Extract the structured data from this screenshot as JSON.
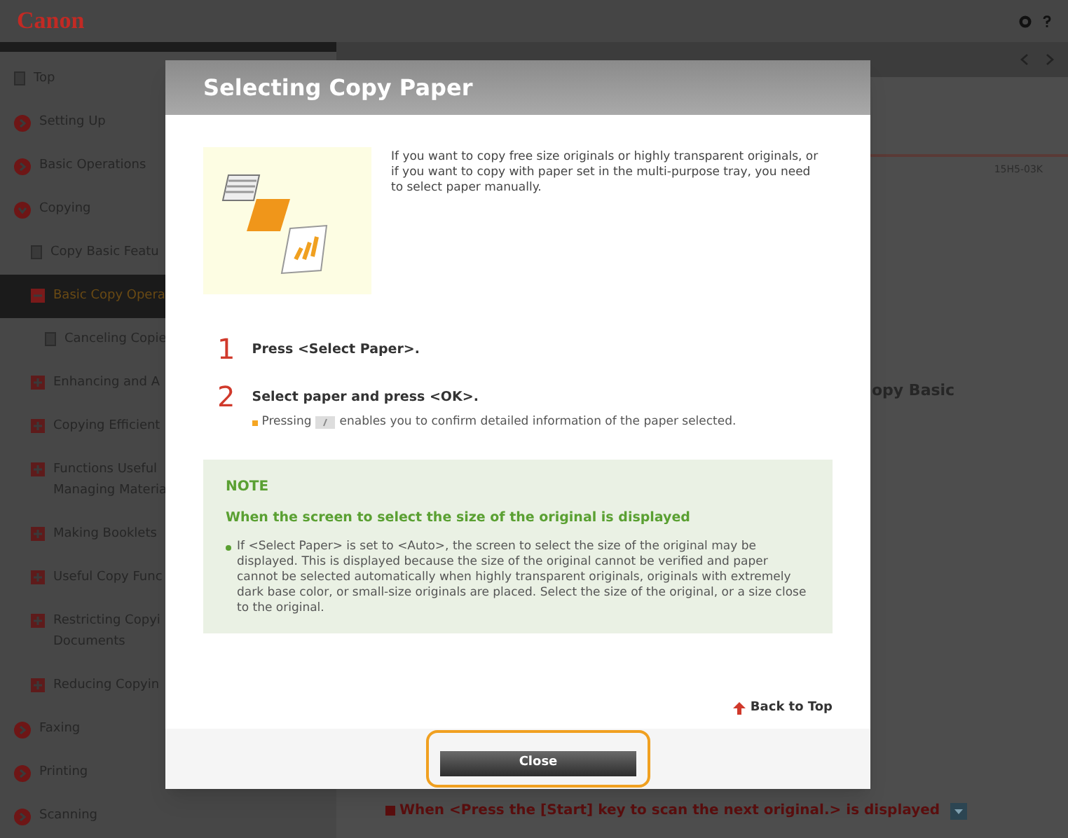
{
  "header": {
    "logo": "Canon"
  },
  "sidebar": {
    "items": [
      {
        "label": "Top",
        "kind": "page",
        "selected": false
      },
      {
        "label": "Setting Up",
        "kind": "section",
        "expanded": false,
        "selected": false
      },
      {
        "label": "Basic Operations",
        "kind": "section",
        "expanded": false,
        "selected": false
      },
      {
        "label": "Copying",
        "kind": "section",
        "expanded": true,
        "selected": false,
        "children": [
          {
            "label": "Copy Basic Featu",
            "kind": "page",
            "selected": false
          },
          {
            "label": "Basic Copy Opera",
            "kind": "topic",
            "expanded": true,
            "selected": true,
            "children": [
              {
                "label": "Canceling Copie",
                "kind": "page",
                "selected": false
              }
            ]
          },
          {
            "label": "Enhancing and A",
            "kind": "topic",
            "expanded": false,
            "selected": false
          },
          {
            "label": "Copying Efficient",
            "kind": "topic",
            "expanded": false,
            "selected": false
          },
          {
            "label": "Functions Useful\nManaging Materia",
            "kind": "topic",
            "expanded": false,
            "selected": false
          },
          {
            "label": "Making Booklets",
            "kind": "topic",
            "expanded": false,
            "selected": false
          },
          {
            "label": "Useful Copy Func",
            "kind": "topic",
            "expanded": false,
            "selected": false
          },
          {
            "label": "Restricting Copyi\nDocuments",
            "kind": "topic",
            "expanded": false,
            "selected": false
          },
          {
            "label": "Reducing Copyin",
            "kind": "topic",
            "expanded": false,
            "selected": false
          }
        ]
      },
      {
        "label": "Faxing",
        "kind": "section",
        "expanded": false,
        "selected": false
      },
      {
        "label": "Printing",
        "kind": "section",
        "expanded": false,
        "selected": false
      },
      {
        "label": "Scanning",
        "kind": "section",
        "expanded": false,
        "selected": false
      }
    ]
  },
  "content": {
    "doc_code": "15H5-03K",
    "heading_fragment": "opy Basic",
    "bottom_heading": "When <Press the [Start] key to scan the next original.> is displayed"
  },
  "dialog": {
    "title": "Selecting Copy Paper",
    "intro": "If you want to copy free size originals or highly transparent originals, or if you want to copy with paper set in the multi-purpose tray, you need to select paper manually.",
    "steps": [
      {
        "number": "1",
        "text": "Press <Select Paper>."
      },
      {
        "number": "2",
        "text": "Select paper and press <OK>.",
        "note_before": "Pressing",
        "note_after": "enables you to confirm detailed information of the paper selected."
      }
    ],
    "note": {
      "label": "NOTE",
      "heading": "When the screen to select the size of the original is displayed",
      "bullet": "If <Select Paper> is set to <Auto>, the screen to select the size of the original may be displayed. This is displayed because the size of the original cannot be verified and paper cannot be selected automatically when highly transparent originals, originals with extremely dark base color, or small-size originals are placed. Select the size of the original, or a size close to the original."
    },
    "back_to_top": "Back to Top",
    "close_button": "Close"
  }
}
